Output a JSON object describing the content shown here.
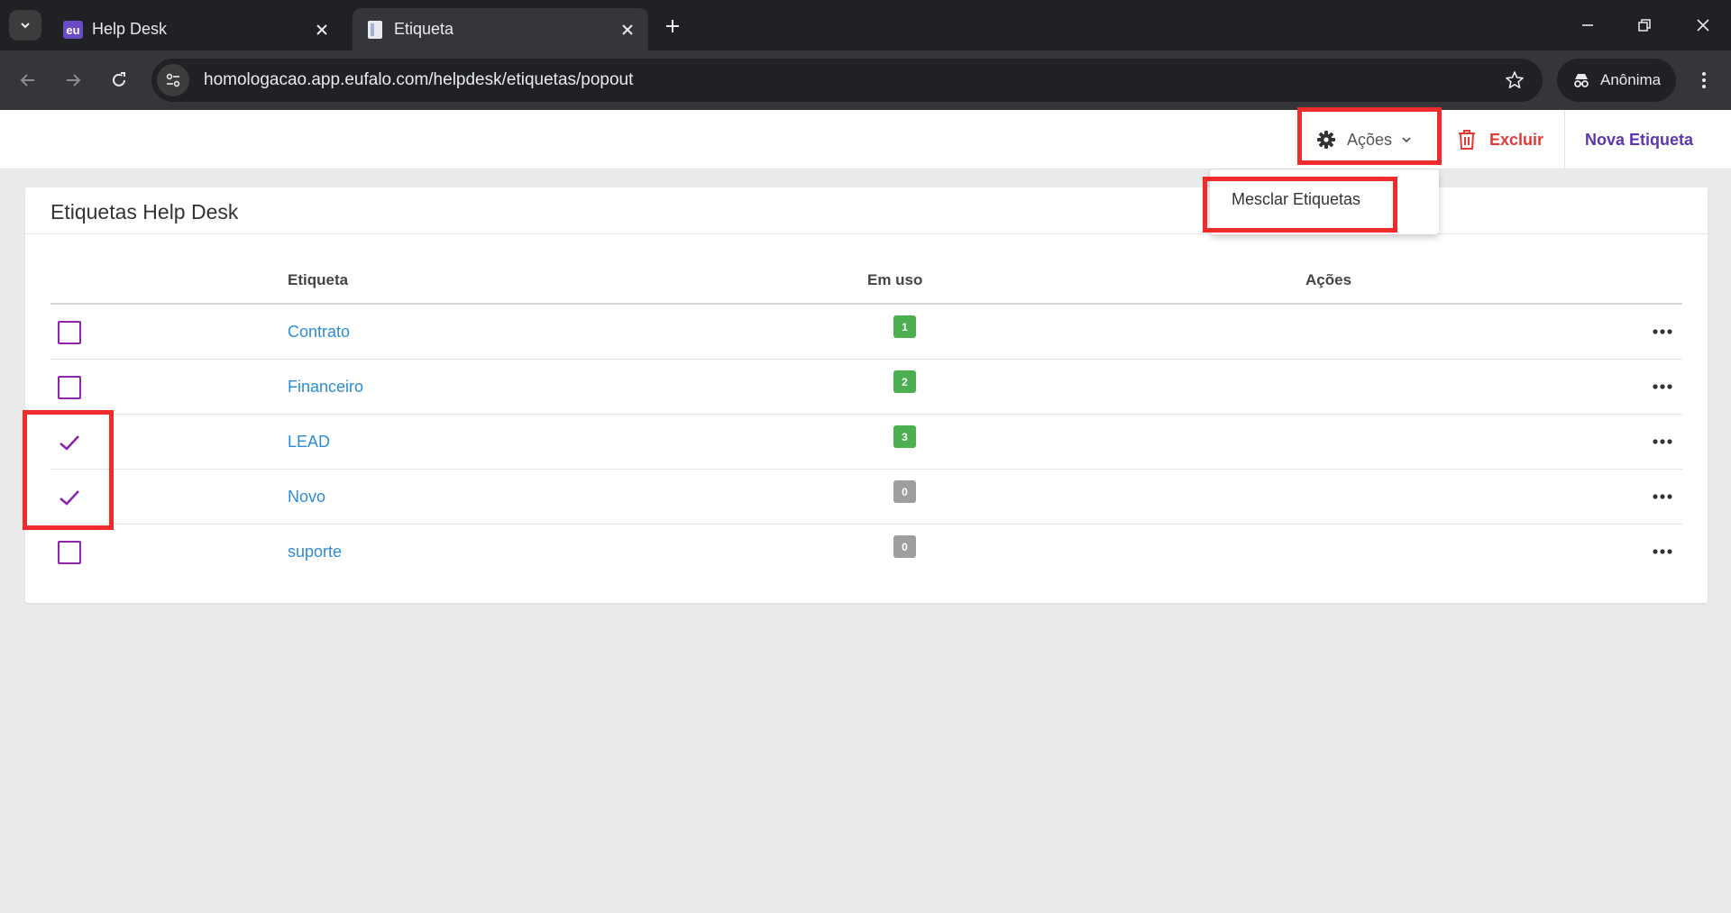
{
  "browser": {
    "tabs": [
      {
        "title": "Help Desk",
        "favicon_text": "eu"
      },
      {
        "title": "Etiqueta"
      }
    ],
    "url": "homologacao.app.eufalo.com/helpdesk/etiquetas/popout",
    "profile_label": "Anônima"
  },
  "header": {
    "actions_label": "Ações",
    "delete_label": "Excluir",
    "new_label": "Nova Etiqueta"
  },
  "dropdown": {
    "items": [
      {
        "label": "Mesclar Etiquetas"
      }
    ]
  },
  "card": {
    "title": "Etiquetas Help Desk",
    "columns": {
      "tag": "Etiqueta",
      "in_use": "Em uso",
      "actions": "Ações"
    },
    "rows": [
      {
        "name": "Contrato",
        "count": "1",
        "checked": false,
        "badge_color": "#4caf50"
      },
      {
        "name": "Financeiro",
        "count": "2",
        "checked": false,
        "badge_color": "#4caf50"
      },
      {
        "name": "LEAD",
        "count": "3",
        "checked": true,
        "badge_color": "#4caf50"
      },
      {
        "name": "Novo",
        "count": "0",
        "checked": true,
        "badge_color": "#9e9e9e"
      },
      {
        "name": "suporte",
        "count": "0",
        "checked": false,
        "badge_color": "#9e9e9e"
      }
    ]
  },
  "colors": {
    "accent_purple": "#8e24aa",
    "link_blue": "#2d8cd6",
    "danger_red": "#e53935",
    "annotation_red": "#ef2b2b"
  },
  "icons": [
    "tab-search-icon",
    "close-icon",
    "plus-icon",
    "minimize-icon",
    "restore-icon",
    "back-icon",
    "forward-icon",
    "reload-icon",
    "site-settings-icon",
    "star-icon",
    "incognito-icon",
    "more-vert-icon",
    "gear-icon",
    "chevron-down-icon",
    "trash-icon",
    "check-icon",
    "more-horiz-icon"
  ]
}
